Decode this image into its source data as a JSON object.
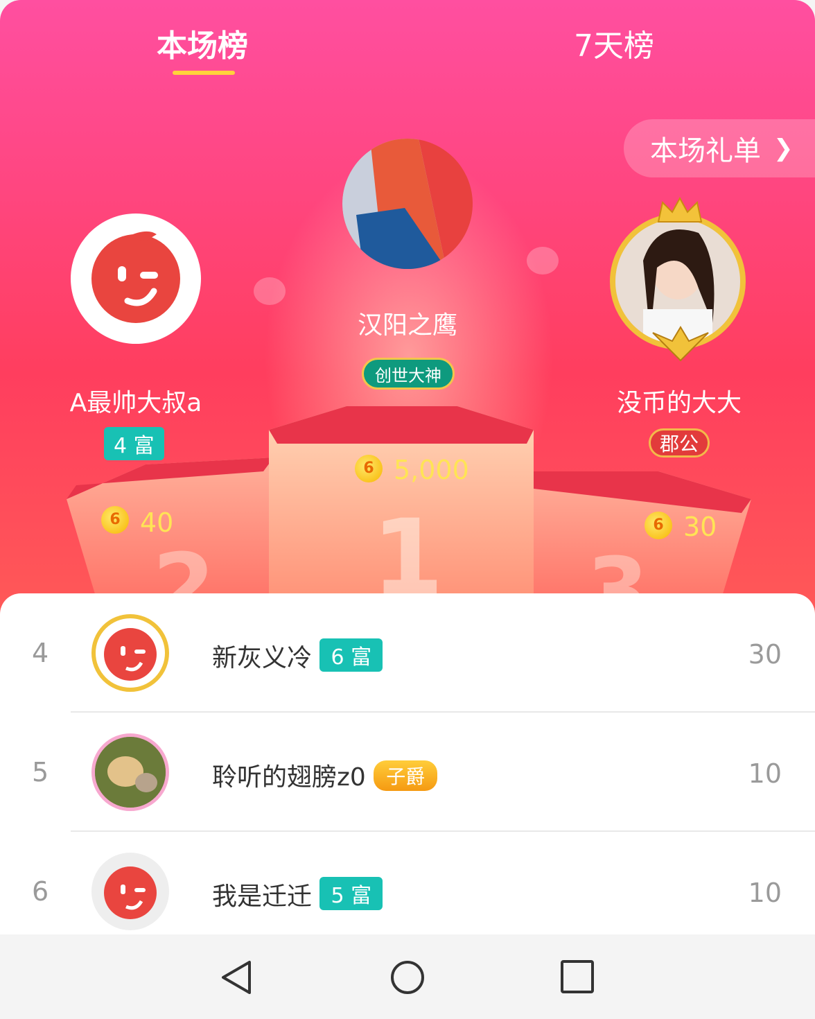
{
  "tabs": {
    "current": "本场榜",
    "week": "7天榜"
  },
  "gift_list_button": {
    "label": "本场礼单"
  },
  "podium": {
    "first": {
      "name": "汉阳之鹰",
      "title_badge": "创世大神",
      "coins": "5,000",
      "number": "1"
    },
    "second": {
      "name": "A最帅大叔a",
      "level_badge": "4 富",
      "coins": "40",
      "number": "2"
    },
    "third": {
      "name": "没币的大大",
      "title_badge": "郡公",
      "coins": "30",
      "number": "3"
    }
  },
  "coin_glyph": "6",
  "list": [
    {
      "rank": "4",
      "name": "新灰义冷",
      "badge": "6 富",
      "badge_type": "teal",
      "value": "30"
    },
    {
      "rank": "5",
      "name": "聆听的翅膀z0",
      "badge": "子爵",
      "badge_type": "gold",
      "value": "10"
    },
    {
      "rank": "6",
      "name": "我是迁迁",
      "badge": "5 富",
      "badge_type": "teal",
      "value": "10"
    }
  ],
  "colors": {
    "accent": "#ff4f8a",
    "teal_badge": "#18c1b4",
    "indicator": "#ffd23b",
    "coin": "#ffe455"
  },
  "nav": {
    "back": "back-triangle-icon",
    "home": "home-circle-icon",
    "recent": "recent-square-icon"
  }
}
